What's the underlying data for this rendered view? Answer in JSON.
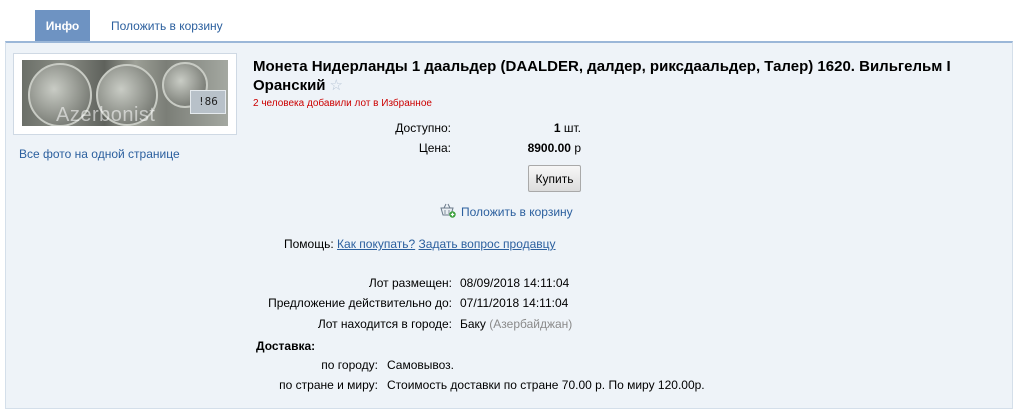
{
  "tabs": {
    "active": "Инфо",
    "cart": "Положить в корзину"
  },
  "photo": {
    "watermark": "Azerbonist",
    "scale_reading": "!86"
  },
  "all_photos_link": "Все фото на одной странице",
  "lot": {
    "title": "Монета Нидерланды 1 даальдер (DAALDER, далдер, риксдаальдер, Талер) 1620. Вильгельм I Оранский",
    "favorites": "2 человека добавили лот в Избранное"
  },
  "purchase": {
    "available_label": "Доступно:",
    "available_qty": "1",
    "available_unit": "шт.",
    "price_label": "Цена:",
    "price_value": "8900.00",
    "price_currency": "р",
    "buy_button": "Купить",
    "add_to_cart": "Положить в корзину"
  },
  "help": {
    "label": "Помощь:",
    "how_to_buy": "Как покупать?",
    "ask_seller": "Задать вопрос продавцу"
  },
  "details": {
    "posted_label": "Лот размещен:",
    "posted_value": "08/09/2018 14:11:04",
    "valid_label": "Предложение действительно до:",
    "valid_value": "07/11/2018 14:11:04",
    "city_label": "Лот находится в городе:",
    "city_value": "Баку",
    "country_value": "(Азербайджан)"
  },
  "delivery": {
    "heading": "Доставка:",
    "city_label": "по городу:",
    "city_value": "Самовывоз.",
    "world_label": "по стране и миру:",
    "world_value": "Стоимость доставки по стране 70.00 р. По миру 120.00р."
  },
  "colors": {
    "tab_active": "#6e93c2",
    "panel_bg": "#eef3f8",
    "link": "#2b5f9e",
    "favorites": "#cc0000"
  }
}
